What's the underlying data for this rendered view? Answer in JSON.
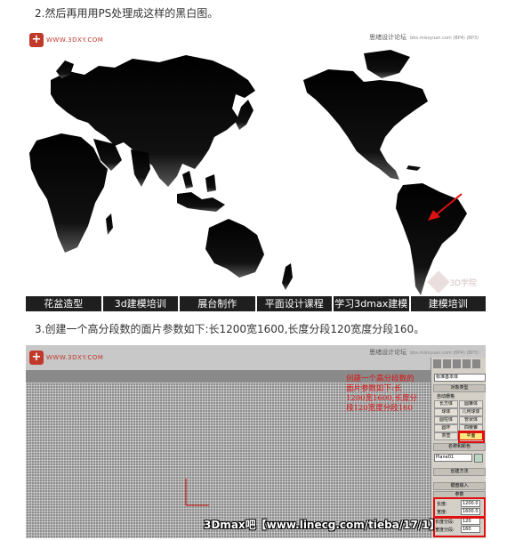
{
  "step2": "2.然后再用用PS处理成这样的黑白图。",
  "step3": "3.创建一个高分段数的面片参数如下:长1200宽1600,长度分段120宽度分段160。",
  "figure1": {
    "logo_text": "WWW.3DXY.COM",
    "header_right": "思绪设计论坛",
    "header_right_small": "bbs.missyuan.com (BP4) (BP3)",
    "watermark": "3D学院",
    "tabs": [
      "花盆造型",
      "3d建模培训",
      "展台制作",
      "平面设计课程",
      "学习3dmax建模",
      "建模培训"
    ]
  },
  "figure2": {
    "logo_text": "WWW.3DXY.COM",
    "header_right": "思绪设计论坛",
    "header_right_small": "bbs.missyuan.com (BP4) (BP3)",
    "annotation": "创建一个高分段数的面片参数如下:长1200宽1600,长度分段120宽度分段160",
    "panel": {
      "dropdown": "标准基本体",
      "object_type": "对象类型",
      "autogrid": "自动栅格",
      "buttons": [
        "长方体",
        "圆锥体",
        "球体",
        "几何球体",
        "圆柱体",
        "管状体",
        "圆环",
        "四棱锥",
        "茶壶",
        "平面"
      ],
      "name_color": "名称和颜色",
      "name_value": "Plane01",
      "creation_method": "创建方法",
      "keyboard_entry": "键盘输入",
      "parameters": "参数",
      "length_label": "长度:",
      "length_value": "1200.0",
      "width_label": "宽度:",
      "width_value": "1600.0",
      "len_segs_label": "长度分段:",
      "len_segs_value": "120",
      "wid_segs_label": "宽度分段:",
      "wid_segs_value": "160"
    }
  },
  "credit": "3Dmax吧【www.linecg.com/tieba/17/1】",
  "colors": {
    "accent_red": "#e01010",
    "logo_red": "#c0392b",
    "tabbar": "#1f1f1f",
    "viewport": "#8c8c8c"
  }
}
